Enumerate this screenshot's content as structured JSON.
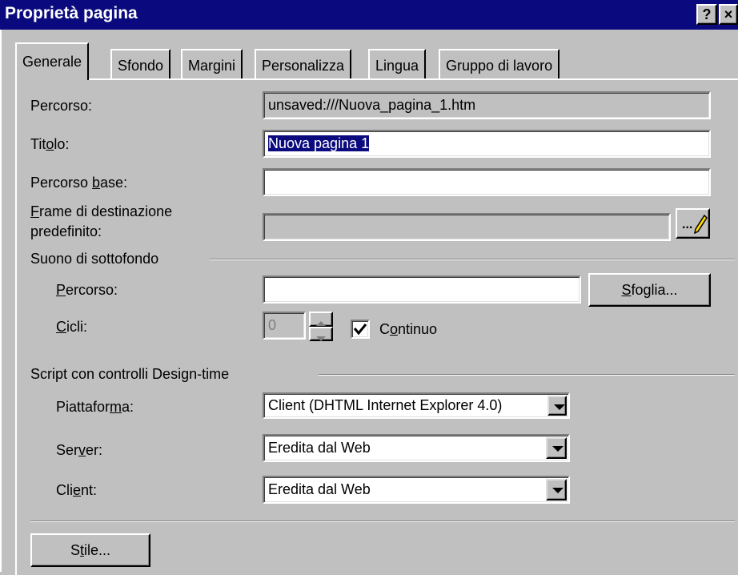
{
  "window": {
    "title": "Proprietà pagina",
    "help_glyph": "?",
    "close_glyph": "×"
  },
  "tabs": [
    "Generale",
    "Sfondo",
    "Margini",
    "Personalizza",
    "Lingua",
    "Gruppo di lavoro"
  ],
  "selected_tab": "Generale",
  "general": {
    "percorso_label": "Percorso:",
    "percorso_value": "unsaved:///Nuova_pagina_1.htm",
    "titolo_label": "Titolo:",
    "titolo_value": "Nuova pagina 1",
    "percorso_base_label": "Percorso base:",
    "percorso_base_value": "",
    "frame_label_1": "Frame di destinazione",
    "frame_label_2": "predefinito:",
    "frame_value": "",
    "frame_button": "..."
  },
  "sound": {
    "group_label": "Suono di sottofondo",
    "percorso_label": "Percorso:",
    "percorso_value": "",
    "browse_button": "Sfoglia...",
    "cicli_label": "Cicli:",
    "cicli_value": "0",
    "continuo_label": "Continuo",
    "continuo_checked": true
  },
  "script": {
    "group_label": "Script con controlli Design-time",
    "piattaforma_label": "Piattaforma:",
    "piattaforma_value": "Client (DHTML Internet Explorer 4.0)",
    "server_label": "Server:",
    "server_value": "Eredita dal Web",
    "client_label": "Client:",
    "client_value": "Eredita dal Web"
  },
  "style_button": "Stile...",
  "colors": {
    "titlebar": "#0a0a7e",
    "face": "#c0c0c0",
    "selection": "#0a0a7e"
  }
}
